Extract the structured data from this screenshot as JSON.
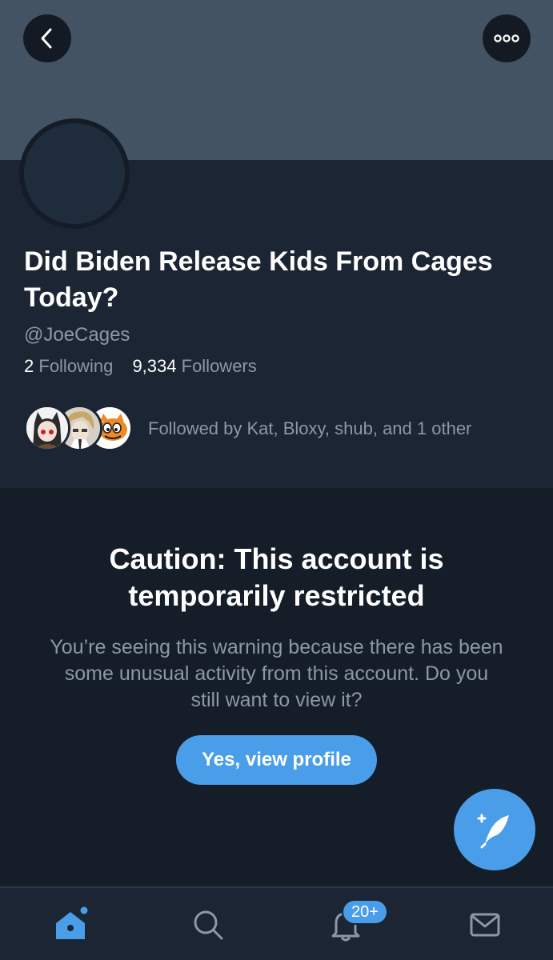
{
  "header": {
    "back_icon": "chevron-left-icon",
    "more_icon": "more-dots-icon"
  },
  "profile": {
    "display_name": "Did Biden Release Kids From Cages Today?",
    "handle": "@JoeCages",
    "following_count": "2",
    "following_label": "Following",
    "followers_count": "9,334",
    "followers_label": "Followers",
    "followed_by_text": "Followed by Kat, Bloxy, shub, and 1 other"
  },
  "warning": {
    "title": "Caution: This account is temporarily restricted",
    "body": "You’re seeing this warning because there has been some unusual activity from this account. Do you still want to view it?",
    "button_label": "Yes, view profile"
  },
  "tabbar": {
    "tabs": [
      {
        "name": "home",
        "icon": "home-icon"
      },
      {
        "name": "search",
        "icon": "search-icon"
      },
      {
        "name": "notifications",
        "icon": "bell-icon"
      },
      {
        "name": "messages",
        "icon": "envelope-icon"
      }
    ],
    "notification_badge": "20+"
  },
  "colors": {
    "accent": "#4a9de8",
    "background": "#151d28",
    "profile_background": "#1b2533",
    "banner": "#445363",
    "secondary_text": "#8b98a5"
  }
}
